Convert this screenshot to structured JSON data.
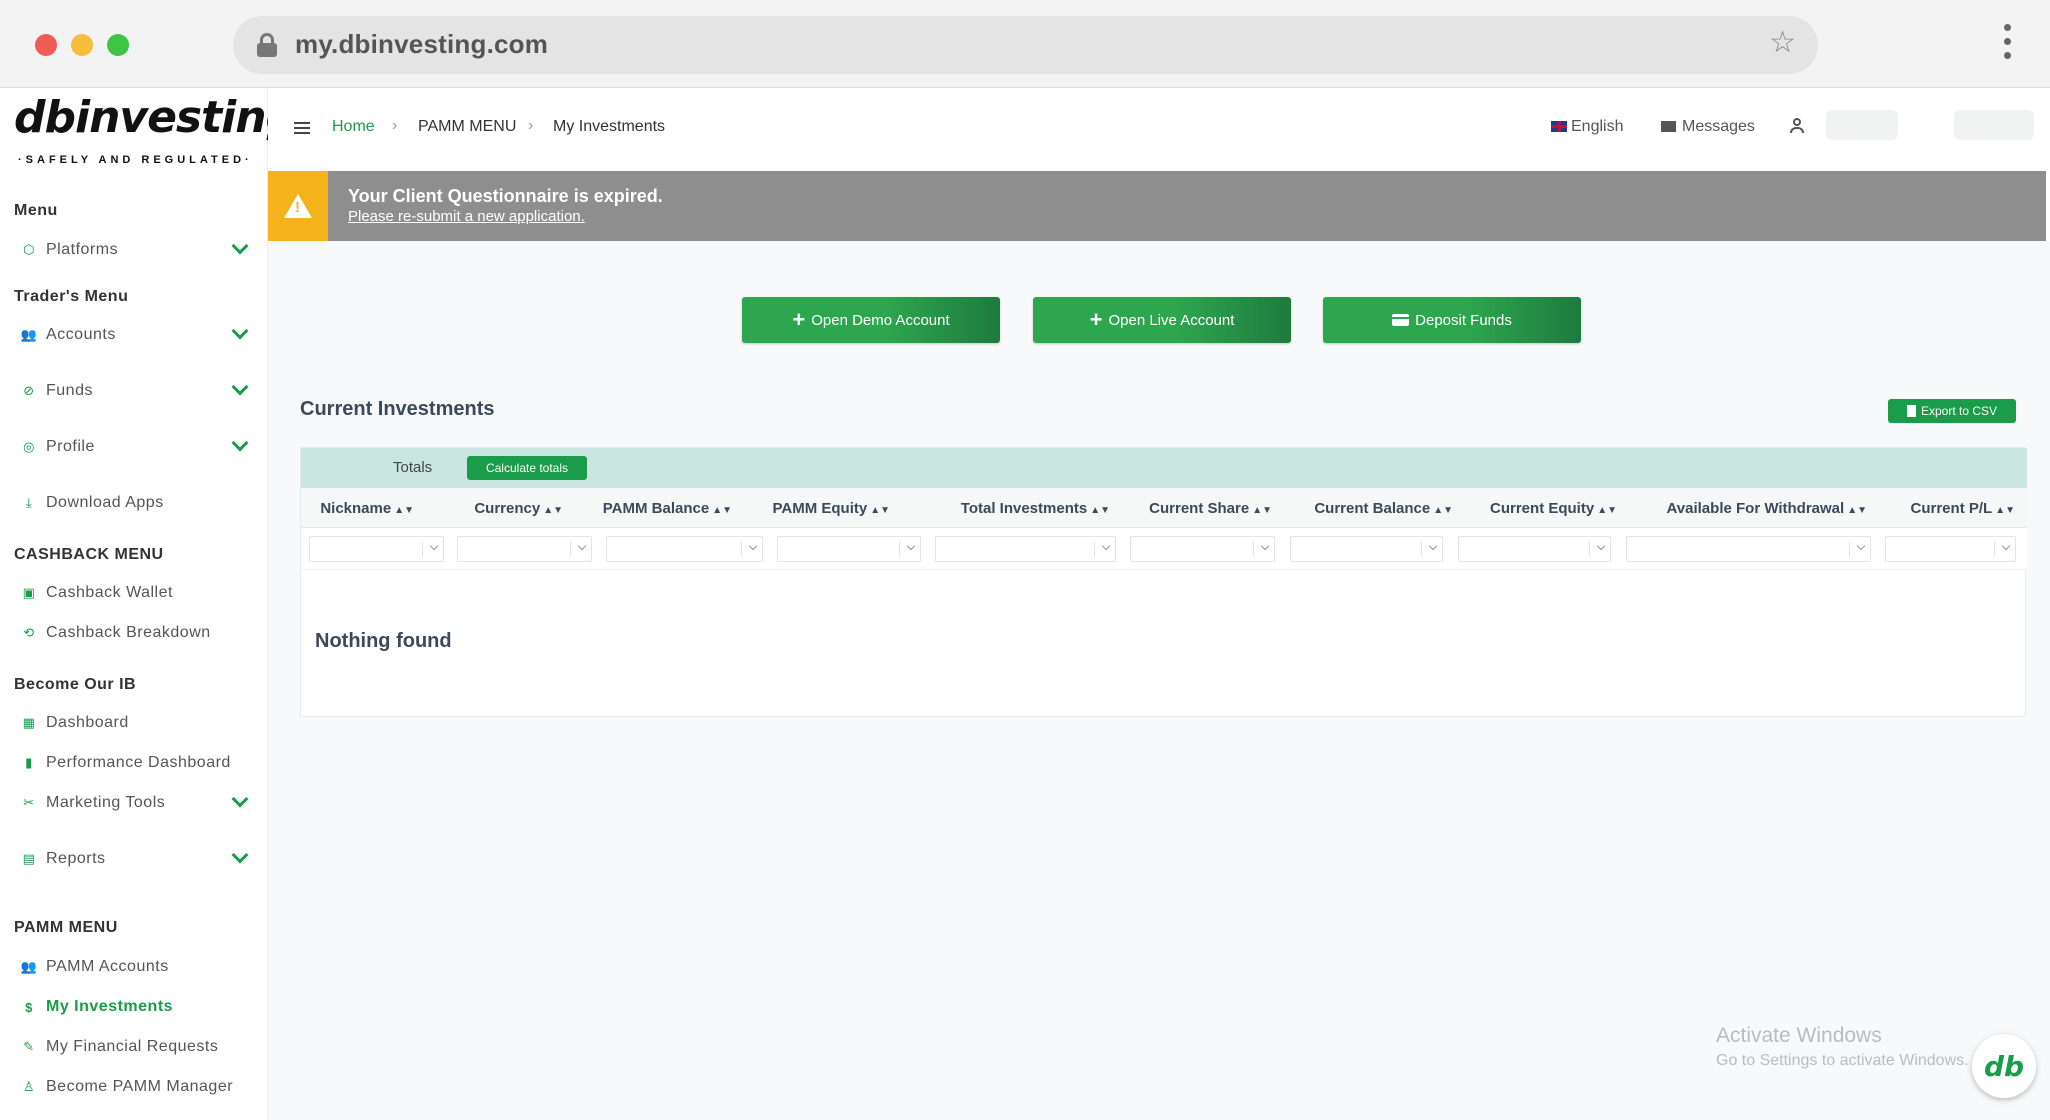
{
  "browser": {
    "url": "my.dbinvesting.com"
  },
  "logo": {
    "text": "dbinvesting",
    "tagline": "·SAFELY AND REGULATED·"
  },
  "sidebar": {
    "sections": {
      "menu": "Menu",
      "traders_menu": "Trader's Menu",
      "cashback_menu": "CASHBACK MENU",
      "become_ib": "Become Our IB",
      "pamm_menu": "PAMM MENU"
    },
    "items": {
      "platforms": "Platforms",
      "accounts": "Accounts",
      "funds": "Funds",
      "profile": "Profile",
      "download_apps": "Download Apps",
      "cashback_wallet": "Cashback Wallet",
      "cashback_breakdown": "Cashback Breakdown",
      "dashboard": "Dashboard",
      "performance_dashboard": "Performance Dashboard",
      "marketing_tools": "Marketing Tools",
      "reports": "Reports",
      "pamm_accounts": "PAMM Accounts",
      "my_investments": "My Investments",
      "my_financial_requests": "My Financial Requests",
      "become_pamm_manager": "Become PAMM Manager"
    }
  },
  "topbar": {
    "breadcrumb": {
      "home": "Home",
      "section": "PAMM MENU",
      "current": "My Investments"
    },
    "language": "English",
    "messages": "Messages"
  },
  "alert": {
    "title": "Your Client Questionnaire is expired.",
    "link": "Please re-submit a new application."
  },
  "actions": {
    "open_demo": "Open Demo Account",
    "open_live": "Open Live Account",
    "deposit": "Deposit Funds"
  },
  "investments": {
    "title": "Current Investments",
    "export_label": "Export to CSV",
    "totals_label": "Totals",
    "calculate_label": "Calculate totals",
    "columns": [
      "Nickname",
      "Currency",
      "PAMM Balance",
      "PAMM Equity",
      "Total Investments",
      "Current Share",
      "Current Balance",
      "Current Equity",
      "Available For Withdrawal",
      "Current P/L"
    ],
    "empty_text": "Nothing found"
  },
  "watermark": {
    "title": "Activate Windows",
    "subtitle": "Go to Settings to activate Windows."
  },
  "chat": {
    "logo_text": "db"
  }
}
